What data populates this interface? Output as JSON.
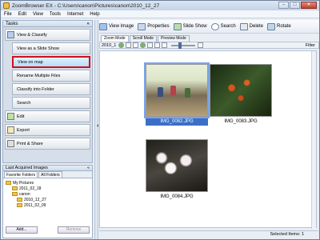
{
  "window": {
    "title": "ZoomBrowser EX  -  C:\\Users\\canon\\Pictures\\canon\\2010_12_27",
    "minimize": "–",
    "maximize": "□",
    "close": "✕"
  },
  "menu": [
    "File",
    "Edit",
    "View",
    "Tools",
    "Internet",
    "Help"
  ],
  "tasks": {
    "header": "Tasks",
    "collapse": "«",
    "items": [
      {
        "label": "View & Classify",
        "kind": "main",
        "icon": "view-icon"
      },
      {
        "label": "View as a Slide Show",
        "kind": "sub"
      },
      {
        "label": "View on map",
        "kind": "sub",
        "highlight": true
      },
      {
        "label": "Rename Multiple Files",
        "kind": "sub"
      },
      {
        "label": "Classify into Folder",
        "kind": "sub"
      },
      {
        "label": "Search",
        "kind": "sub"
      },
      {
        "label": "Edit",
        "kind": "main",
        "icon": "edit-icon"
      },
      {
        "label": "Export",
        "kind": "main",
        "icon": "export-icon"
      },
      {
        "label": "Print & Share",
        "kind": "main",
        "icon": "print-icon"
      }
    ]
  },
  "last_acquired": {
    "label": "Last Acquired Images",
    "collapse": "«"
  },
  "folders": {
    "tabs": [
      "Favorite Folders",
      "All Folders"
    ],
    "tree": [
      "My Pictures",
      "2011_02_18",
      "canon",
      "2010_12_27",
      "2011_02_09"
    ],
    "add": "Add...",
    "remove": "Remove"
  },
  "toolbar": {
    "view_image": "View Image",
    "properties": "Properties",
    "slide_show": "Slide Show",
    "search": "Search",
    "delete": "Delete",
    "rotate": "Rotate"
  },
  "modes": [
    "Zoom Mode",
    "Scroll Mode",
    "Preview Mode"
  ],
  "viewbar": {
    "folder_fragment": "2010_1",
    "filter": "Filter"
  },
  "images": [
    {
      "name": "IMG_0082.JPG",
      "selected": true
    },
    {
      "name": "IMG_0083.JPG",
      "selected": false
    },
    {
      "name": "IMG_0084.JPG",
      "selected": false
    }
  ],
  "status": {
    "text": "Selected Items: 1"
  }
}
